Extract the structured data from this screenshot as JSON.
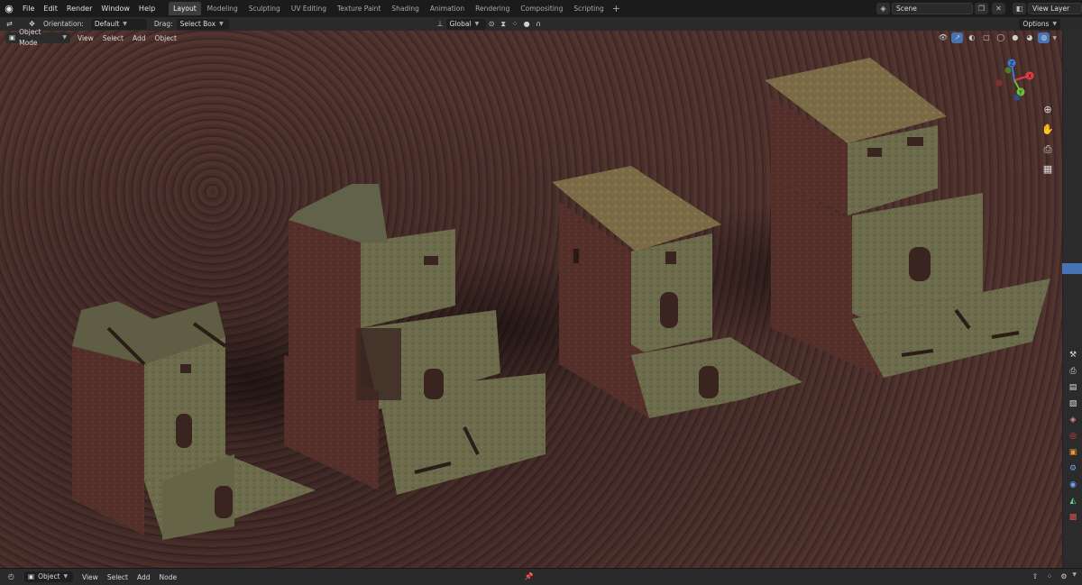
{
  "topbar": {
    "menu": [
      "File",
      "Edit",
      "Render",
      "Window",
      "Help"
    ],
    "workspaces": [
      "Layout",
      "Modeling",
      "Sculpting",
      "UV Editing",
      "Texture Paint",
      "Shading",
      "Animation",
      "Rendering",
      "Compositing",
      "Scripting"
    ],
    "active_workspace": "Layout",
    "scene": "Scene",
    "view_layer": "View Layer"
  },
  "toolbar": {
    "orientation_label": "Orientation:",
    "orientation_value": "Default",
    "drag_label": "Drag:",
    "drag_value": "Select Box",
    "transform_orientation": "Global",
    "options_label": "Options"
  },
  "viewport_header": {
    "mode": "Object Mode",
    "menus": [
      "View",
      "Select",
      "Add",
      "Object"
    ]
  },
  "bottombar": {
    "mode": "Object",
    "menus": [
      "View",
      "Select",
      "Add",
      "Node"
    ]
  },
  "gizmo": {
    "x_label": "X",
    "y_label": "Y",
    "z_label": "Z",
    "x_color": "#e63946",
    "y_color": "#6bbf3a",
    "z_color": "#3d7ad6"
  },
  "colors": {
    "accent": "#4772b3",
    "ground": "#4a302c",
    "stone": "#6f6e4f",
    "brick": "#5a2e2a"
  }
}
